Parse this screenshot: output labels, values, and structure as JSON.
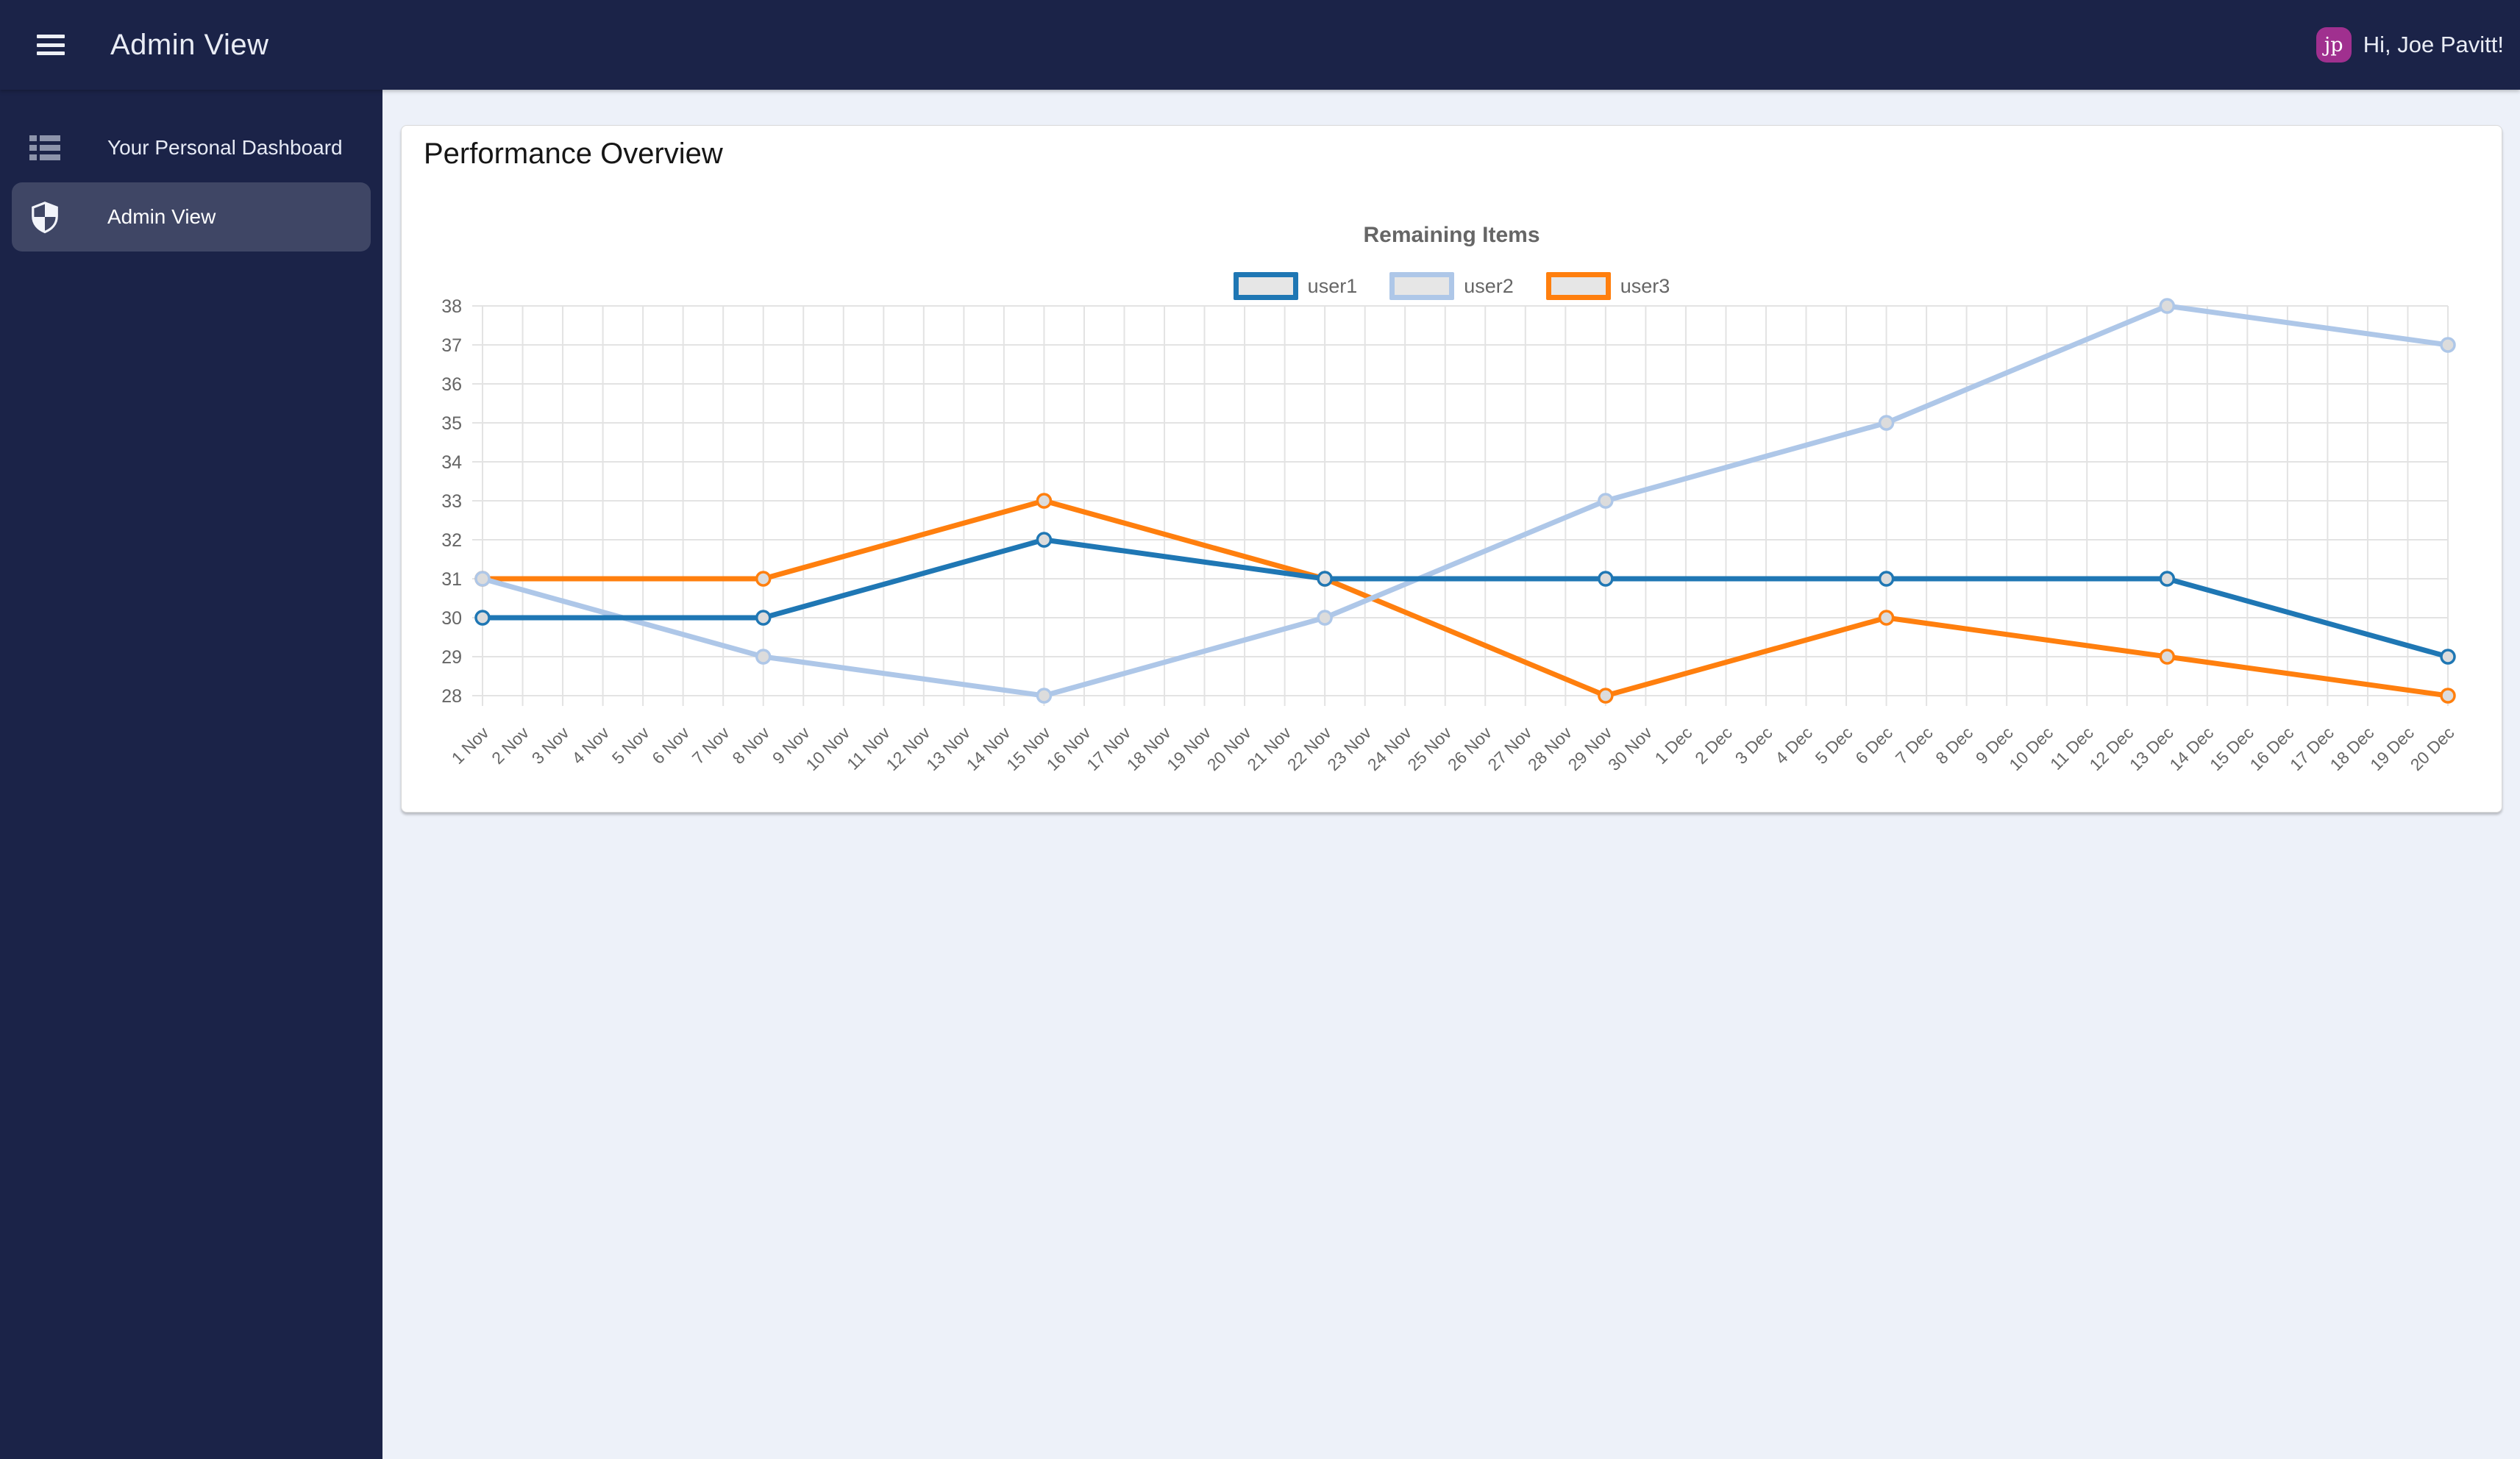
{
  "topbar": {
    "title": "Admin View",
    "greeting": "Hi, Joe Pavitt!",
    "avatar_initials": "jp"
  },
  "sidebar": {
    "items": [
      {
        "label": "Your Personal Dashboard",
        "icon": "dashboard-list",
        "active": false
      },
      {
        "label": "Admin View",
        "icon": "shield",
        "active": true
      }
    ]
  },
  "page": {
    "heading": "Performance Overview"
  },
  "colors": {
    "navy": "#1b2348",
    "page_bg": "#edf1f9",
    "avatar": "#a0308f",
    "active_item_bg": "rgba(255,255,255,0.16)"
  },
  "chart_data": {
    "type": "line",
    "title": "Remaining Items",
    "legend_position": "top",
    "grid": true,
    "ylim": [
      28,
      38
    ],
    "y_tick_step": 1,
    "x_labels": [
      "1 Nov",
      "2 Nov",
      "3 Nov",
      "4 Nov",
      "5 Nov",
      "6 Nov",
      "7 Nov",
      "8 Nov",
      "9 Nov",
      "10 Nov",
      "11 Nov",
      "12 Nov",
      "13 Nov",
      "14 Nov",
      "15 Nov",
      "16 Nov",
      "17 Nov",
      "18 Nov",
      "19 Nov",
      "20 Nov",
      "21 Nov",
      "22 Nov",
      "23 Nov",
      "24 Nov",
      "25 Nov",
      "26 Nov",
      "27 Nov",
      "28 Nov",
      "29 Nov",
      "30 Nov",
      "1 Dec",
      "2 Dec",
      "3 Dec",
      "4 Dec",
      "5 Dec",
      "6 Dec",
      "7 Dec",
      "8 Dec",
      "9 Dec",
      "10 Dec",
      "11 Dec",
      "12 Dec",
      "13 Dec",
      "14 Dec",
      "15 Dec",
      "16 Dec",
      "17 Dec",
      "18 Dec",
      "19 Dec",
      "20 Dec"
    ],
    "series": [
      {
        "name": "user1",
        "color": "#1f77b4",
        "x_indices": [
          0,
          7,
          14,
          21,
          28,
          35,
          42,
          49
        ],
        "values": [
          30,
          30,
          32,
          31,
          31,
          31,
          31,
          29
        ]
      },
      {
        "name": "user2",
        "color": "#aec7e8",
        "x_indices": [
          0,
          7,
          14,
          21,
          28,
          35,
          42,
          49
        ],
        "values": [
          31,
          29,
          28,
          30,
          33,
          35,
          38,
          37
        ]
      },
      {
        "name": "user3",
        "color": "#ff7f0e",
        "x_indices": [
          0,
          7,
          14,
          21,
          28,
          35,
          42,
          49
        ],
        "values": [
          31,
          31,
          33,
          31,
          28,
          30,
          29,
          28
        ]
      }
    ],
    "styles": {
      "grid_color": "#e3e3e3",
      "tick_label_color": "#666666",
      "title_color": "#666666",
      "marker_fill": "#dcdcdc",
      "legend_box_fill": "#e6e6e6"
    }
  }
}
